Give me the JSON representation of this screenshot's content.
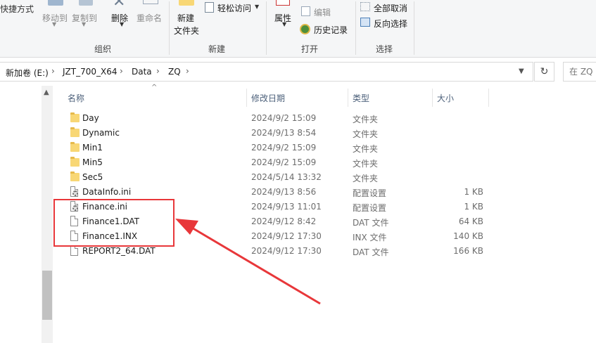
{
  "ribbon": {
    "partial_paste_shortcut": "快捷方式",
    "move_to": "移动到",
    "copy_to": "复制到",
    "delete": "删除",
    "rename": "重命名",
    "new_folder_line1": "新建",
    "new_folder_line2": "文件夹",
    "easy_access": "轻松访问",
    "properties": "属性",
    "edit": "编辑",
    "history": "历史记录",
    "select_none": "全部取消",
    "invert_selection": "反向选择",
    "groups": {
      "organize": "组织",
      "new": "新建",
      "open": "打开",
      "select": "选择"
    }
  },
  "address": {
    "crumbs": [
      "新加卷 (E:)",
      "JZT_700_X64",
      "Data",
      "ZQ"
    ],
    "search_placeholder": "在 ZQ"
  },
  "columns": {
    "name": "名称",
    "date": "修改日期",
    "type": "类型",
    "size": "大小"
  },
  "files": [
    {
      "name": "Day",
      "date": "2024/9/2 15:09",
      "type": "文件夹",
      "size": "",
      "icon": "folder-icon"
    },
    {
      "name": "Dynamic",
      "date": "2024/9/13 8:54",
      "type": "文件夹",
      "size": "",
      "icon": "folder-icon"
    },
    {
      "name": "Min1",
      "date": "2024/9/2 15:09",
      "type": "文件夹",
      "size": "",
      "icon": "folder-icon"
    },
    {
      "name": "Min5",
      "date": "2024/9/2 15:09",
      "type": "文件夹",
      "size": "",
      "icon": "folder-icon"
    },
    {
      "name": "Sec5",
      "date": "2024/5/14 13:32",
      "type": "文件夹",
      "size": "",
      "icon": "folder-icon"
    },
    {
      "name": "DataInfo.ini",
      "date": "2024/9/13 8:56",
      "type": "配置设置",
      "size": "1 KB",
      "icon": "settings-file-icon"
    },
    {
      "name": "Finance.ini",
      "date": "2024/9/13 11:01",
      "type": "配置设置",
      "size": "1 KB",
      "icon": "settings-file-icon"
    },
    {
      "name": "Finance1.DAT",
      "date": "2024/9/12 8:42",
      "type": "DAT 文件",
      "size": "64 KB",
      "icon": "file-icon"
    },
    {
      "name": "Finance1.INX",
      "date": "2024/9/12 17:30",
      "type": "INX 文件",
      "size": "140 KB",
      "icon": "file-icon"
    },
    {
      "name": "REPORT2_64.DAT",
      "date": "2024/9/12 17:30",
      "type": "DAT 文件",
      "size": "166 KB",
      "icon": "file-icon"
    }
  ],
  "annotation": {
    "color": "#e8373a"
  }
}
